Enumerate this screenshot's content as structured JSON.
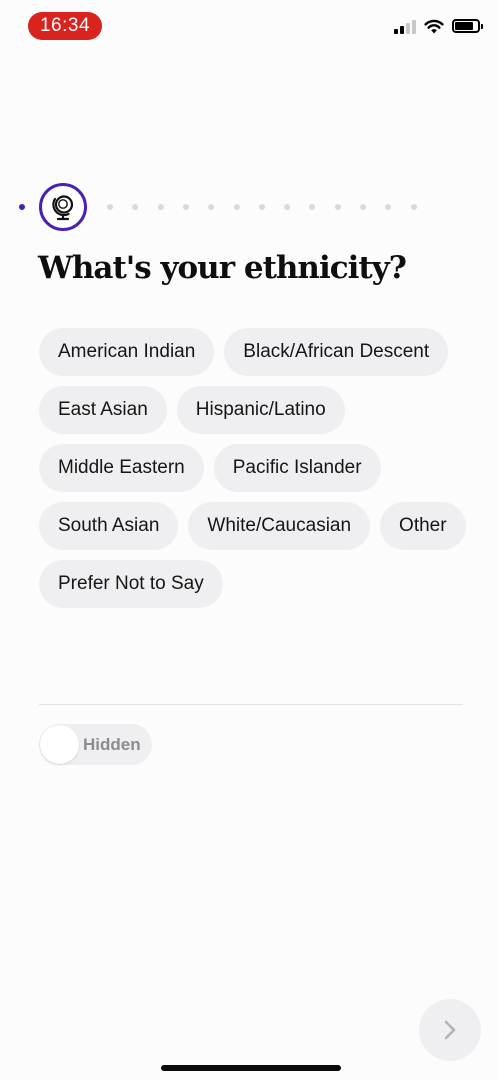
{
  "status_bar": {
    "time": "16:34",
    "time_pill_color": "#d8231f"
  },
  "progress": {
    "active_color": "#4b1fb5",
    "current_icon": "globe-icon",
    "remaining_steps": 13
  },
  "question": {
    "title": "What's your ethnicity?"
  },
  "options": [
    "American Indian",
    "Black/African Descent",
    "East Asian",
    "Hispanic/Latino",
    "Middle Eastern",
    "Pacific Islander",
    "South Asian",
    "White/Caucasian",
    "Other",
    "Prefer Not to Say"
  ],
  "visibility_toggle": {
    "label": "Hidden",
    "on": false
  },
  "next_button": {
    "icon": "chevron-right-icon",
    "enabled": false
  }
}
